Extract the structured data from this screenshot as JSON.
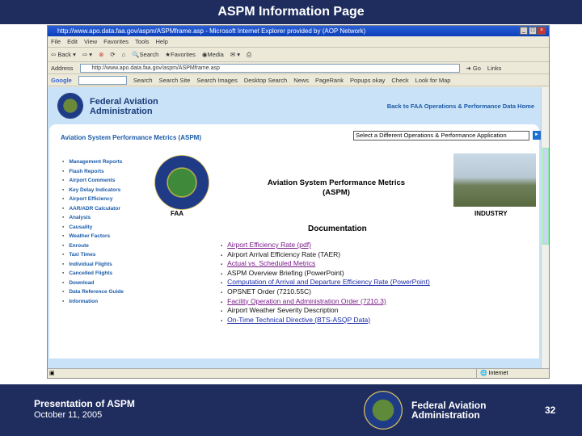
{
  "slide": {
    "title": "ASPM Information Page",
    "footer_title": "Presentation of ASPM",
    "footer_date": "October 11, 2005",
    "footer_org_line1": "Federal Aviation",
    "footer_org_line2": "Administration",
    "page_number": "32"
  },
  "browser": {
    "window_title": "http://www.apo.data.faa.gov/aspm/ASPMframe.asp - Microsoft Internet Explorer provided by (AOP Network)",
    "menu": [
      "File",
      "Edit",
      "View",
      "Favorites",
      "Tools",
      "Help"
    ],
    "toolbar": [
      "Back",
      "Search",
      "Favorites",
      "Media"
    ],
    "address_label": "Address",
    "address": "http://www.apo.data.faa.gov/aspm/ASPMframe.asp",
    "go_label": "Go",
    "links_label": "Links",
    "google": {
      "logo": "Google",
      "items": [
        "Search",
        "Search Site",
        "Search Images",
        "Desktop Search",
        "News",
        "PageRank",
        "Popups okay",
        "Check",
        "Look for Map"
      ]
    },
    "status": "Internet"
  },
  "page": {
    "org_line1": "Federal Aviation",
    "org_line2": "Administration",
    "back_link": "Back to FAA Operations & Performance Data Home",
    "aspm_heading": "Aviation System Performance Metrics (ASPM)",
    "app_select": "Select a Different Operations & Performance Application",
    "go": "►",
    "nav": [
      "Management Reports",
      "Flash Reports",
      "Airport Comments",
      "Key Delay Indicators",
      "Airport Efficiency",
      "AAR/ADR Calculator",
      "Analysis",
      "Causality",
      "Weather Factors",
      "Enroute",
      "Taxi Times",
      "Individual Flights",
      "Cancelled Flights",
      "Download",
      "Data Reference Guide",
      "Information"
    ],
    "faa_label": "FAA",
    "main_title_1": "Aviation System Performance Metrics",
    "main_title_2": "(ASPM)",
    "industry_label": "INDUSTRY",
    "doc_title": "Documentation",
    "docs": [
      {
        "text": "Airport Efficiency Rate (pdf)",
        "style": "v"
      },
      {
        "text": "Airport Arrival Efficiency Rate (TAER)",
        "style": "p"
      },
      {
        "text": "Actual vs. Scheduled Metrics",
        "style": "v"
      },
      {
        "text": "ASPM Overview Briefing (PowerPoint)",
        "style": "p"
      },
      {
        "text": "Computation of Arrival and Departure Efficiency Rate (PowerPoint)",
        "style": "l"
      },
      {
        "text": "OPSNET Order (7210.55C)",
        "style": "p"
      },
      {
        "text": "Facility Operation and Administration Order (7210.3)",
        "style": "v"
      },
      {
        "text": "Airport Weather Severity Description",
        "style": "p"
      },
      {
        "text": "On-Time Technical Directive (BTS-ASQP Data)",
        "style": "l"
      }
    ]
  }
}
